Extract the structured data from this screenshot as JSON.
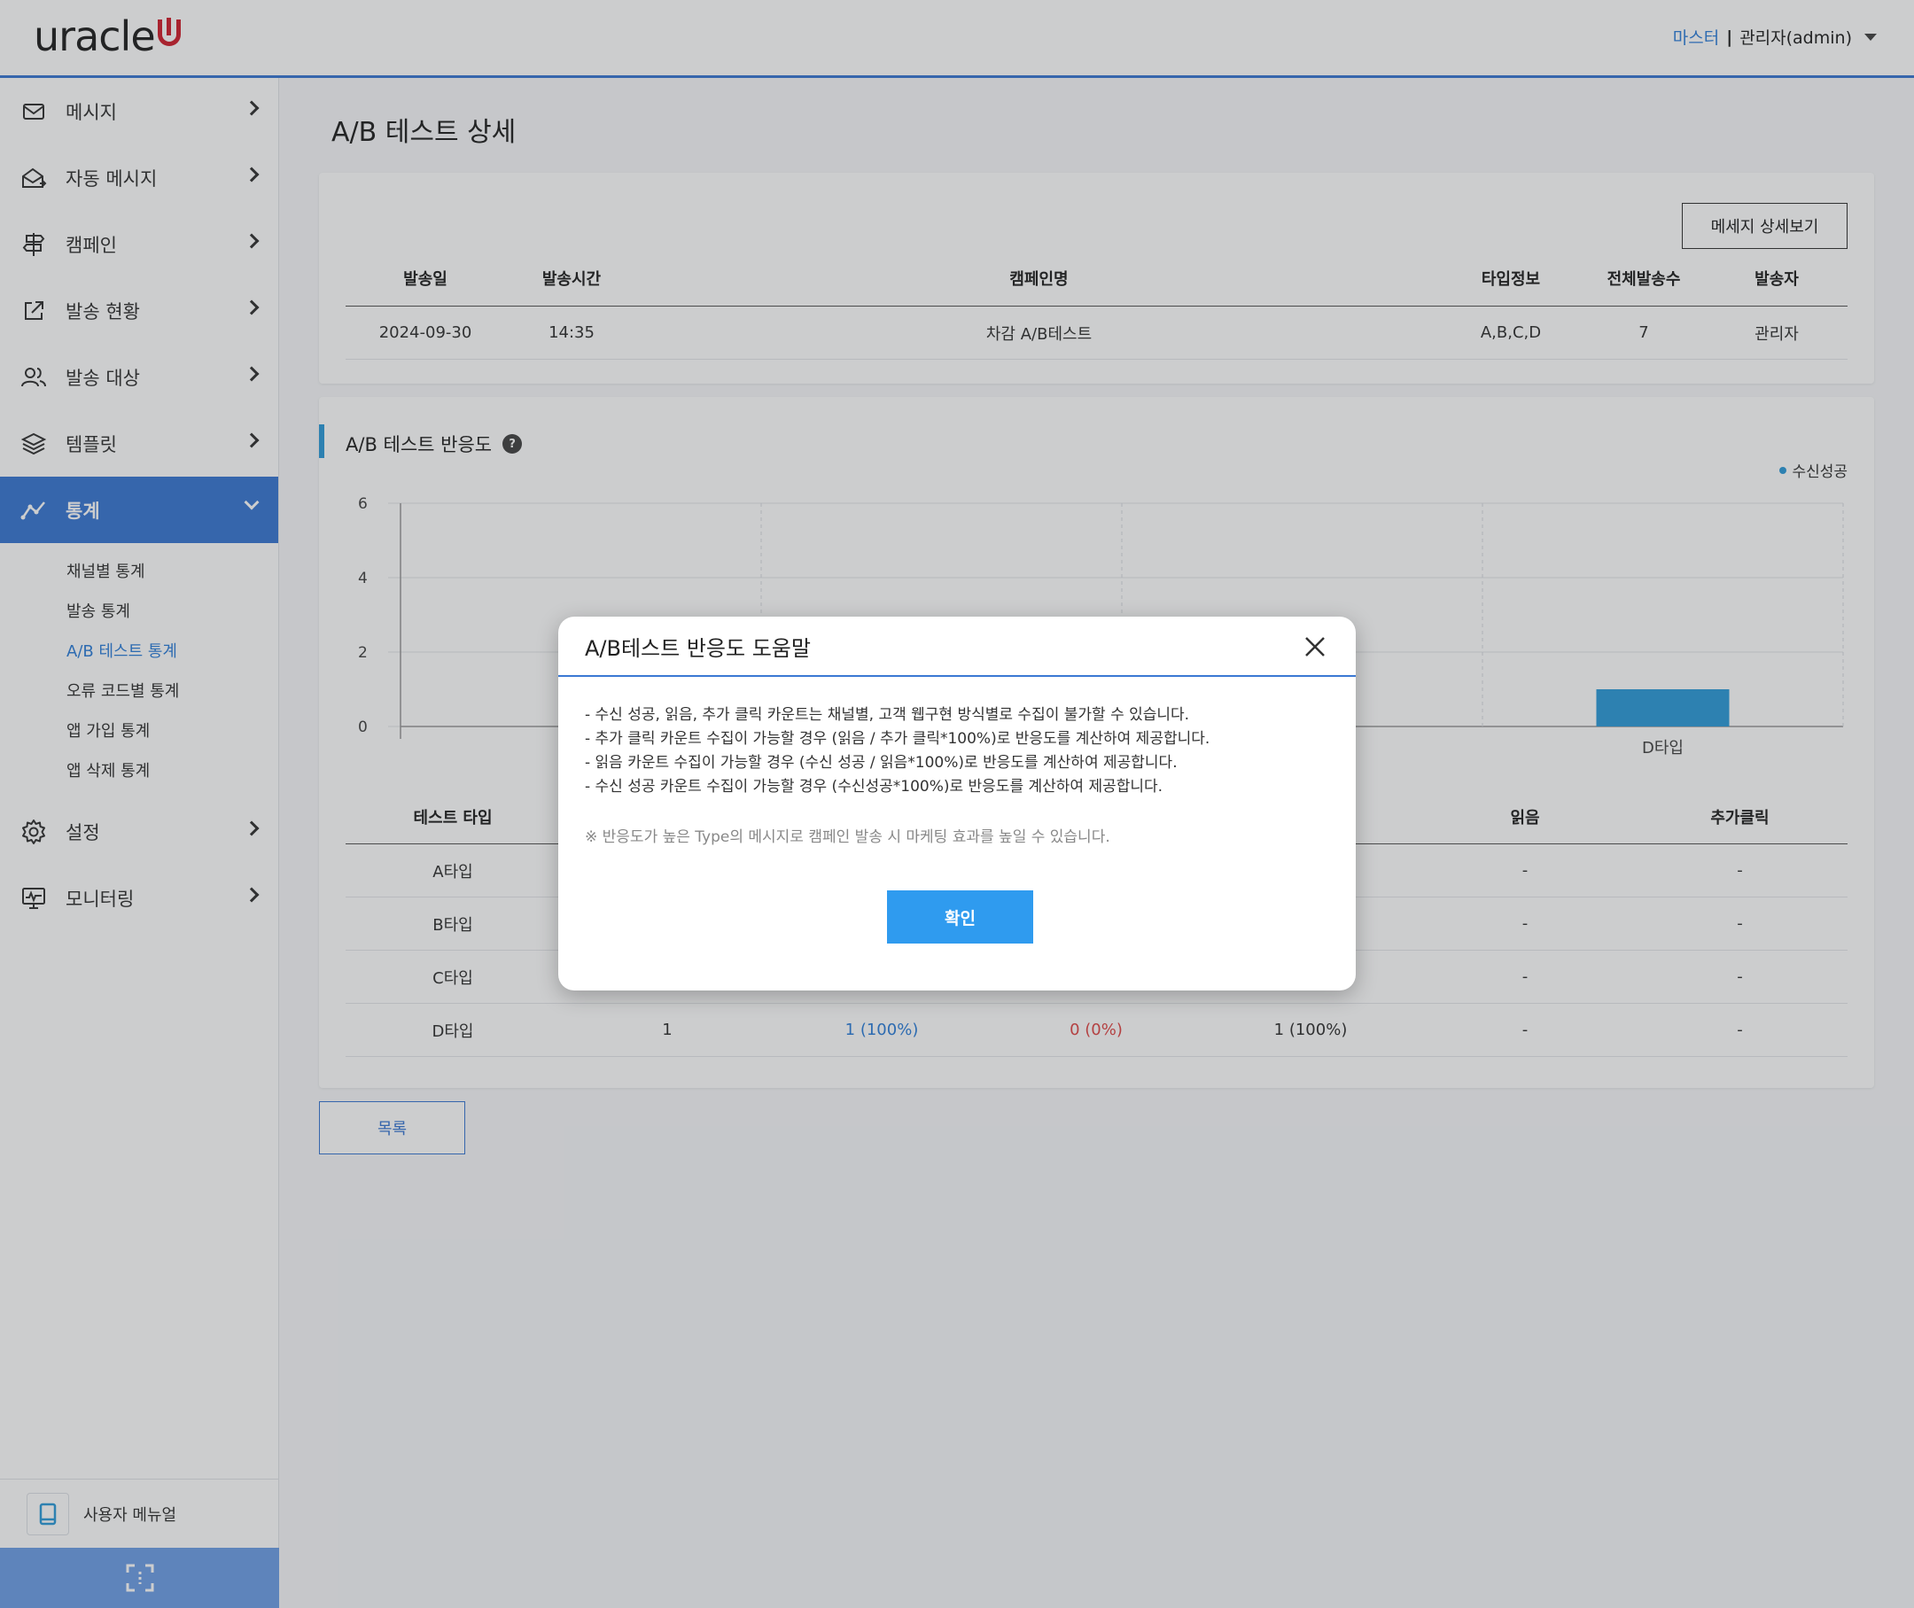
{
  "header": {
    "logo_text": "uracle",
    "user_role": "마스터",
    "separator": "|",
    "user_name": "관리자(admin)"
  },
  "sidebar": {
    "items": [
      {
        "label": "메시지",
        "icon": "mail-icon"
      },
      {
        "label": "자동 메시지",
        "icon": "mail-open-icon"
      },
      {
        "label": "캠페인",
        "icon": "signpost-icon"
      },
      {
        "label": "발송 현황",
        "icon": "external-link-icon"
      },
      {
        "label": "발송 대상",
        "icon": "users-icon"
      },
      {
        "label": "템플릿",
        "icon": "layers-icon"
      },
      {
        "label": "통계",
        "icon": "chart-line-icon"
      },
      {
        "label": "설정",
        "icon": "gear-icon"
      },
      {
        "label": "모니터링",
        "icon": "monitor-icon"
      }
    ],
    "sub_items": [
      "채널별 통계",
      "발송 통계",
      "A/B 테스트 통계",
      "오류 코드별 통계",
      "앱 가입 통계",
      "앱 삭제 통계"
    ],
    "manual_label": "사용자 메뉴얼"
  },
  "page": {
    "title": "A/B 테스트 상세",
    "detail_button": "메세지 상세보기",
    "list_button": "목록"
  },
  "info_table": {
    "headers": [
      "발송일",
      "발송시간",
      "캠페인명",
      "타입정보",
      "전체발송수",
      "발송자"
    ],
    "row": [
      "2024-09-30",
      "14:35",
      "차감 A/B테스트",
      "A,B,C,D",
      "7",
      "관리자"
    ]
  },
  "section": {
    "title": "A/B 테스트 반응도",
    "help": "?"
  },
  "chart_data": {
    "type": "bar",
    "categories": [
      "A타입",
      "B타입",
      "C타입",
      "D타입"
    ],
    "visible_category_labels": [
      "D타입"
    ],
    "series": [
      {
        "name": "수신성공",
        "values": [
          0,
          0,
          0,
          1
        ],
        "color": "#2f9bd9"
      }
    ],
    "y_ticks": [
      "0",
      "2",
      "4",
      "6"
    ],
    "ylim": [
      0,
      6
    ],
    "legend_position": "top-right",
    "grid": true
  },
  "result_table": {
    "headers": [
      "테스트 타입",
      "",
      "",
      "",
      "",
      "읽음",
      "추가클릭"
    ],
    "rows": [
      [
        "A타입",
        "",
        "",
        "",
        "",
        "-",
        "-"
      ],
      [
        "B타입",
        "",
        "",
        "",
        "",
        "-",
        "-"
      ],
      [
        "C타입",
        "",
        "",
        "",
        "",
        "-",
        "-"
      ],
      [
        "D타입",
        "1",
        "1 (100%)",
        "0 (0%)",
        "1 (100%)",
        "-",
        "-"
      ]
    ]
  },
  "modal": {
    "title": "A/B테스트 반응도 도움말",
    "lines": [
      "- 수신 성공, 읽음, 추가 클릭 카운트는 채널별, 고객 웹구현 방식별로 수집이 불가할 수 있습니다.",
      "- 추가 클릭 카운트 수집이 가능할 경우 (읽음 / 추가 클릭*100%)로 반응도를 계산하여 제공합니다.",
      "- 읽음 카운트 수집이 가능할 경우 (수신 성공 / 읽음*100%)로 반응도를 계산하여 제공합니다.",
      "- 수신 성공 카운트 수집이 가능할 경우 (수신성공*100%)로 반응도를 계산하여 제공합니다."
    ],
    "note": "※ 반응도가 높은 Type의 메시지로 캠페인 발송 시 마케팅 효과를 높일 수 있습니다.",
    "confirm_label": "확인"
  }
}
